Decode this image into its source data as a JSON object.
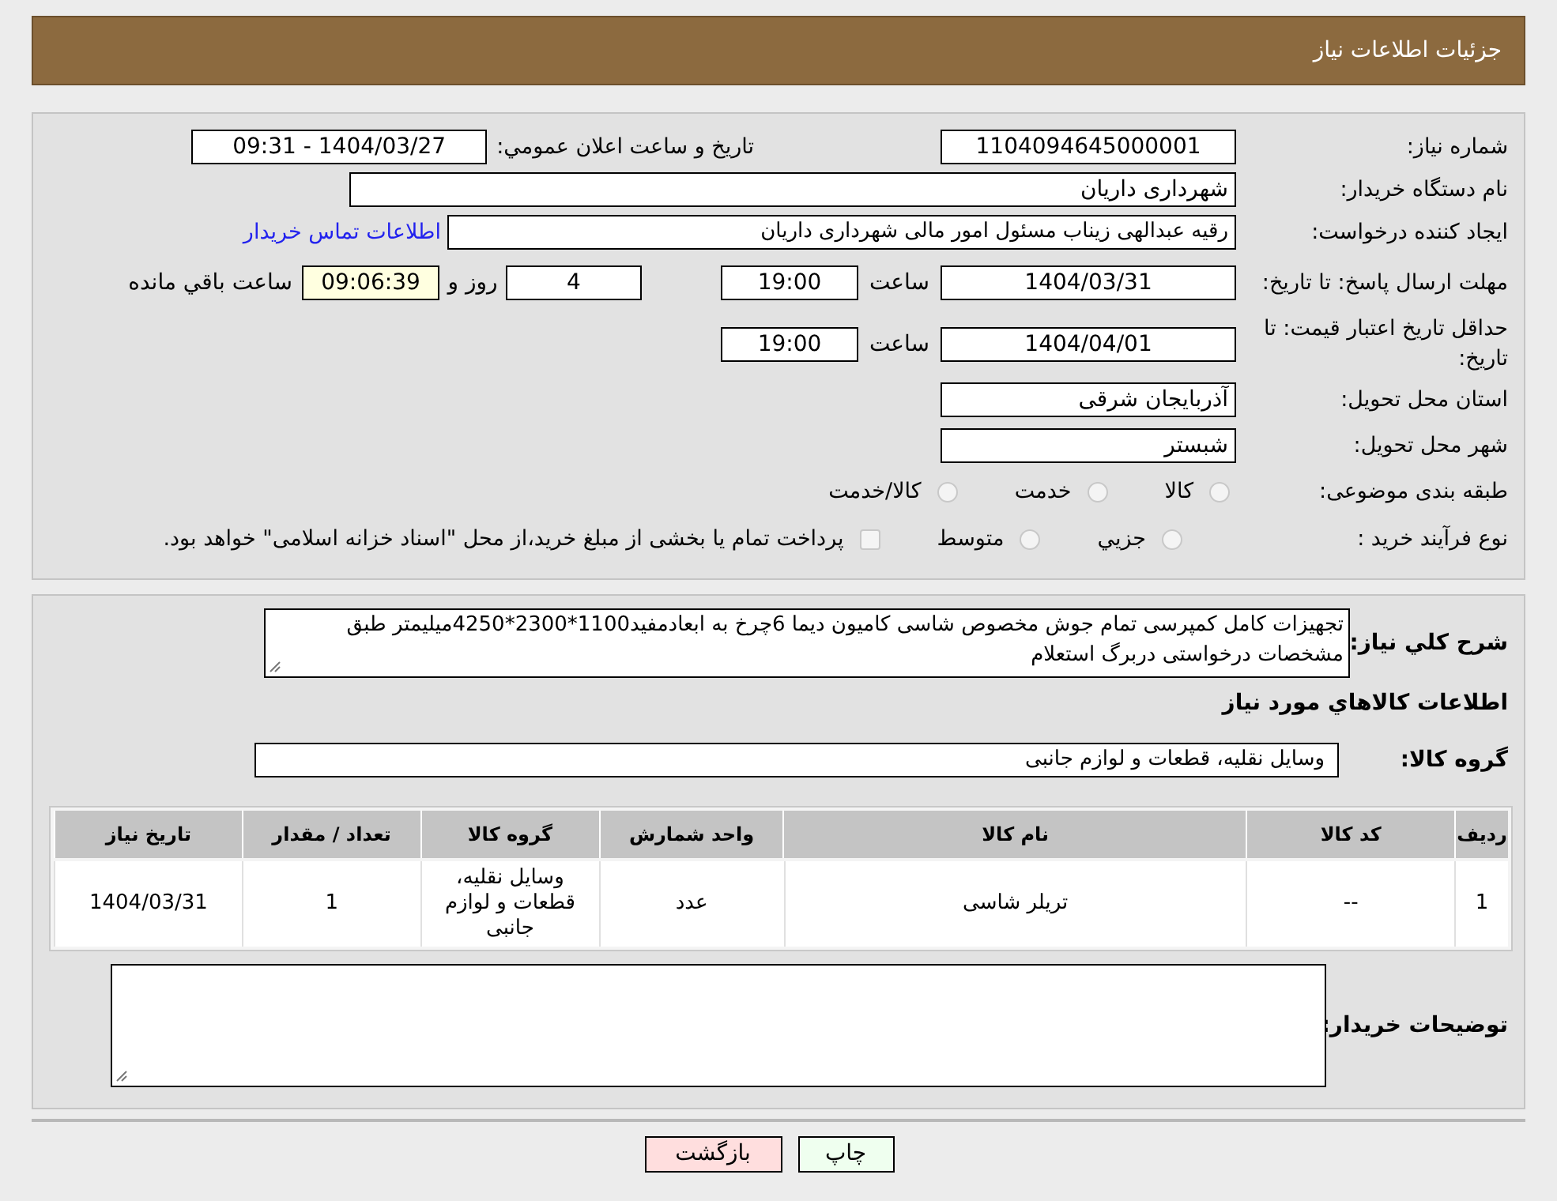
{
  "header": {
    "title": "جزئیات اطلاعات نیاز"
  },
  "need_number": {
    "label": "شماره نیاز:",
    "value": "1104094645000001"
  },
  "announce": {
    "label": "تاريخ و ساعت اعلان عمومي:",
    "value": "1404/03/27 - 09:31"
  },
  "buyer": {
    "label": "نام دستگاه خریدار:",
    "value": "شهرداری داریان"
  },
  "creator": {
    "label": "ایجاد کننده درخواست:",
    "value": "رقیه عبدالهی زیناب مسئول امور مالی شهرداری داریان",
    "contact_link": "اطلاعات تماس خریدار"
  },
  "deadline": {
    "label": "مهلت ارسال پاسخ: تا تاریخ:",
    "date": "1404/03/31",
    "time_label": "ساعت",
    "time": "19:00",
    "days": "4",
    "days_label": "روز و",
    "remaining": "09:06:39",
    "remaining_label": "ساعت باقي مانده"
  },
  "validity": {
    "label": "حداقل تاریخ اعتبار قیمت: تا تاریخ:",
    "date": "1404/04/01",
    "time_label": "ساعت",
    "time": "19:00"
  },
  "province": {
    "label": "استان محل تحویل:",
    "value": "آذربایجان شرقی"
  },
  "city": {
    "label": "شهر محل تحویل:",
    "value": "شبستر"
  },
  "category": {
    "label": "طبقه بندی موضوعی:",
    "options": [
      {
        "label": "کالا",
        "selected": false
      },
      {
        "label": "خدمت",
        "selected": false
      },
      {
        "label": "کالا/خدمت",
        "selected": false
      }
    ]
  },
  "purchase_type": {
    "label": "نوع فرآیند خرید :",
    "options": [
      {
        "label": "جزيي",
        "selected": false
      },
      {
        "label": "متوسط",
        "selected": false
      }
    ],
    "treasury": {
      "label": "پرداخت تمام یا بخشی از مبلغ خرید،از محل \"اسناد خزانه اسلامی\" خواهد بود.",
      "checked": false
    }
  },
  "description": {
    "label": "شرح کلي نياز:",
    "value": "تجهیزات کامل کمپرسی تمام جوش مخصوص شاسی کامیون دیما 6چرخ به ابعادمفید1100*2300*4250میلیمتر طبق مشخصات درخواستی دربرگ استعلام"
  },
  "goods_heading": "اطلاعات کالاهاي مورد نياز",
  "goods_group": {
    "label": "گروه کالا:",
    "value": "وسایل نقلیه، قطعات و لوازم جانبی"
  },
  "table": {
    "columns": [
      "ردیف",
      "کد کالا",
      "نام کالا",
      "واحد شمارش",
      "گروه کالا",
      "تعداد / مقدار",
      "تاریخ نیاز"
    ],
    "rows": [
      [
        "1",
        "--",
        "تریلر شاسی",
        "عدد",
        "وسایل نقلیه، قطعات و لوازم جانبی",
        "1",
        "1404/03/31"
      ]
    ]
  },
  "buyer_notes": {
    "label": "توضیحات خریدار:"
  },
  "buttons": [
    {
      "label": "چاپ",
      "kind": "print"
    },
    {
      "label": "بازگشت",
      "kind": "back"
    }
  ]
}
